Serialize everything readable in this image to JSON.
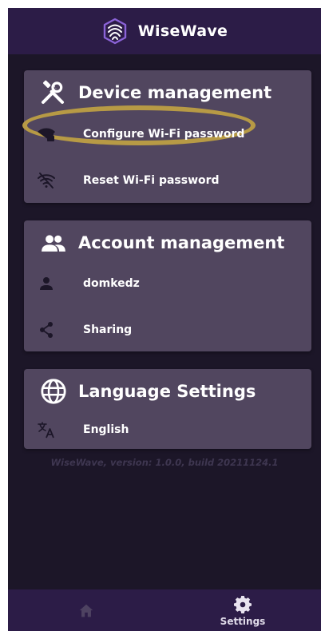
{
  "app": {
    "title": "WiseWave",
    "logo_icon": "fingerprint-wave-logo",
    "accent_color": "#8b63d8"
  },
  "sections": {
    "device": {
      "title": "Device management",
      "icon": "tools-icon",
      "items": [
        {
          "label": "Configure Wi-Fi password",
          "icon": "wifi-lock-icon",
          "highlighted": true
        },
        {
          "label": "Reset Wi-Fi password",
          "icon": "wifi-off-icon"
        }
      ]
    },
    "account": {
      "title": "Account management",
      "icon": "group-icon",
      "items": [
        {
          "label": "domkedz",
          "icon": "person-icon"
        },
        {
          "label": "Sharing",
          "icon": "share-icon"
        }
      ]
    },
    "language": {
      "title": "Language Settings",
      "icon": "globe-icon",
      "items": [
        {
          "label": "English",
          "icon": "translate-icon"
        }
      ]
    }
  },
  "version_text": "WiseWave, version: 1.0.0, build 20211124.1",
  "bottom_nav": {
    "home": {
      "icon": "home-icon"
    },
    "settings": {
      "label": "Settings",
      "icon": "gear-icon",
      "active": true
    }
  },
  "colors": {
    "background": "#1c1628",
    "header": "#2c1c47",
    "card": "#51465f",
    "highlight": "#b79a45"
  }
}
